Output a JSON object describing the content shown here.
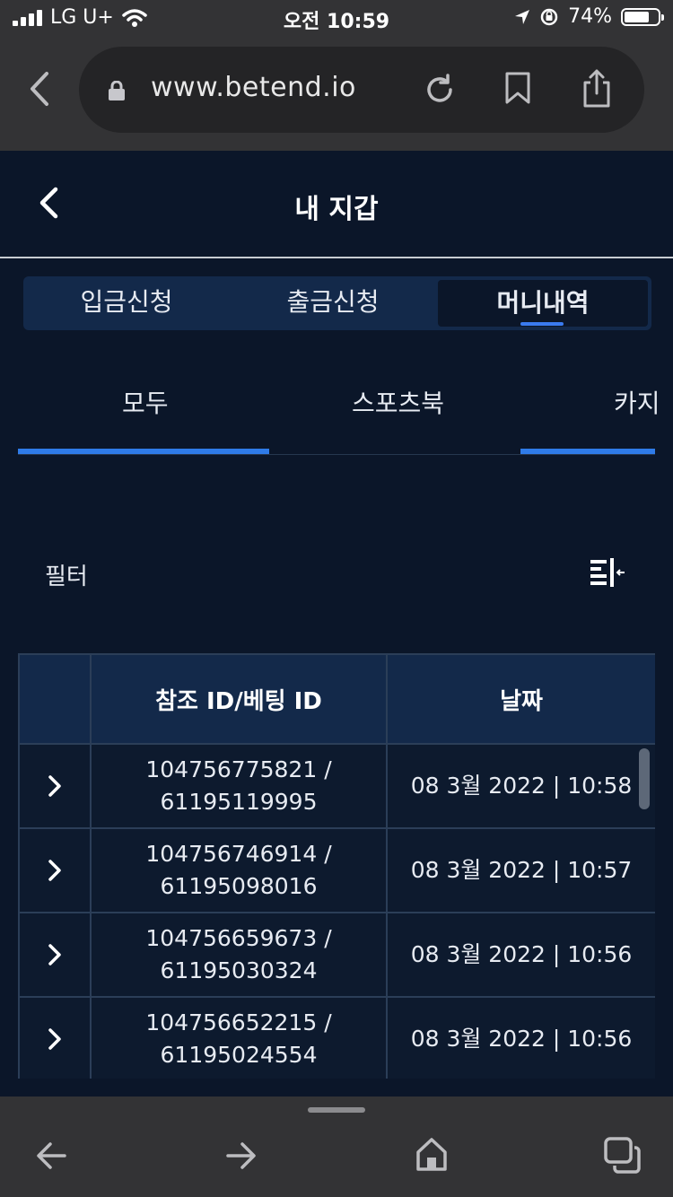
{
  "status_bar": {
    "carrier": "LG U+",
    "time": "오전 10:59",
    "battery": "74%",
    "battery_level": 0.74
  },
  "browser": {
    "url": "www.betend.io"
  },
  "header": {
    "title": "내 지갑"
  },
  "segment_tabs": [
    {
      "label": "입금신청",
      "active": false
    },
    {
      "label": "출금신청",
      "active": false
    },
    {
      "label": "머니내역",
      "active": true
    }
  ],
  "sub_tabs": [
    {
      "label": "모두",
      "active": true
    },
    {
      "label": "스포츠북",
      "active": false
    },
    {
      "label": "카지",
      "active": true
    }
  ],
  "filter": {
    "label": "필터"
  },
  "table": {
    "columns": [
      "",
      "참조 ID/베팅 ID",
      "날짜"
    ],
    "rows": [
      {
        "ref": "104756775821 /",
        "bet": "61195119995",
        "date": "08 3월 2022 | 10:58"
      },
      {
        "ref": "104756746914 /",
        "bet": "61195098016",
        "date": "08 3월 2022 | 10:57"
      },
      {
        "ref": "104756659673 /",
        "bet": "61195030324",
        "date": "08 3월 2022 | 10:56"
      },
      {
        "ref": "104756652215 /",
        "bet": "61195024554",
        "date": "08 3월 2022 | 10:56"
      }
    ]
  },
  "colors": {
    "background": "#0b1629",
    "accent": "#2f7be8",
    "header_cell": "#13294a"
  }
}
